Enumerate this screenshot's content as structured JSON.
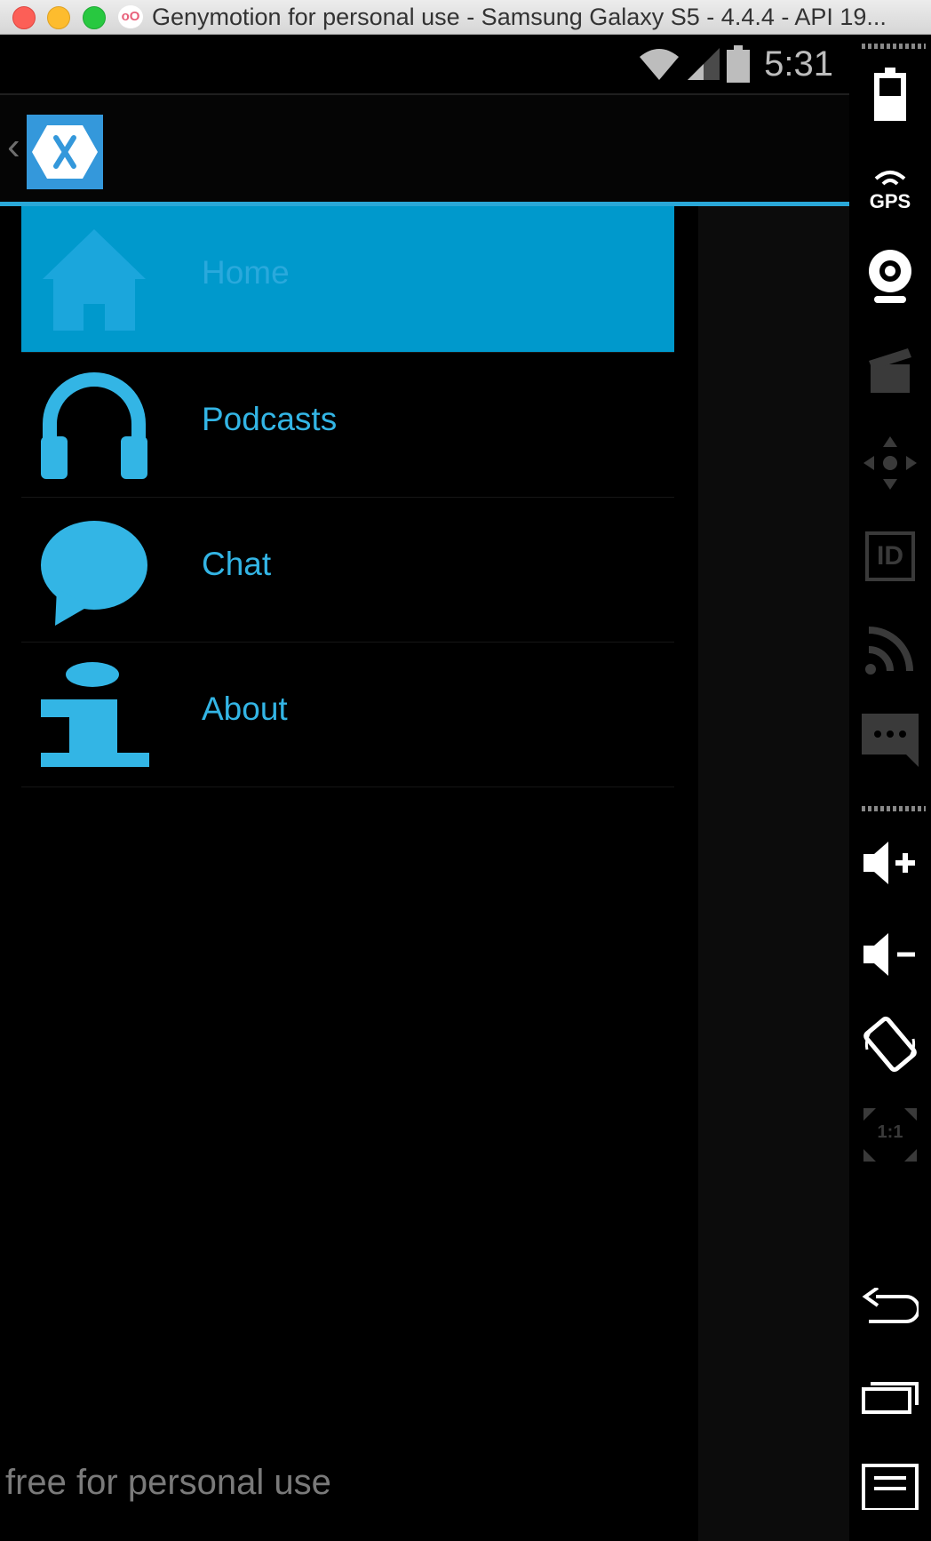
{
  "window": {
    "title": "Genymotion for personal use - Samsung Galaxy S5 - 4.4.4 - API 19...",
    "badge": "oO"
  },
  "statusbar": {
    "time": "5:31"
  },
  "menu": {
    "items": [
      {
        "label": "Home",
        "icon": "home-icon",
        "selected": true
      },
      {
        "label": "Podcasts",
        "icon": "headphones-icon",
        "selected": false
      },
      {
        "label": "Chat",
        "icon": "chat-bubble-icon",
        "selected": false
      },
      {
        "label": "About",
        "icon": "info-icon",
        "selected": false
      }
    ]
  },
  "sidepanel": {
    "gps_label": "GPS",
    "id_label": "ID",
    "scale_label": "1:1",
    "tools": [
      "battery-icon",
      "gps-icon",
      "webcam-icon",
      "clapper-icon",
      "dpad-icon",
      "id-icon",
      "wifi-signal-icon",
      "sms-icon",
      "volume-up-icon",
      "volume-down-icon",
      "rotate-icon",
      "scale-icon",
      "back-icon",
      "recent-apps-icon",
      "menu-icon"
    ]
  },
  "watermark": "free for personal use",
  "colors": {
    "accent": "#33b5e5",
    "selected_bg": "#0099cc",
    "logo": "#3498db"
  }
}
